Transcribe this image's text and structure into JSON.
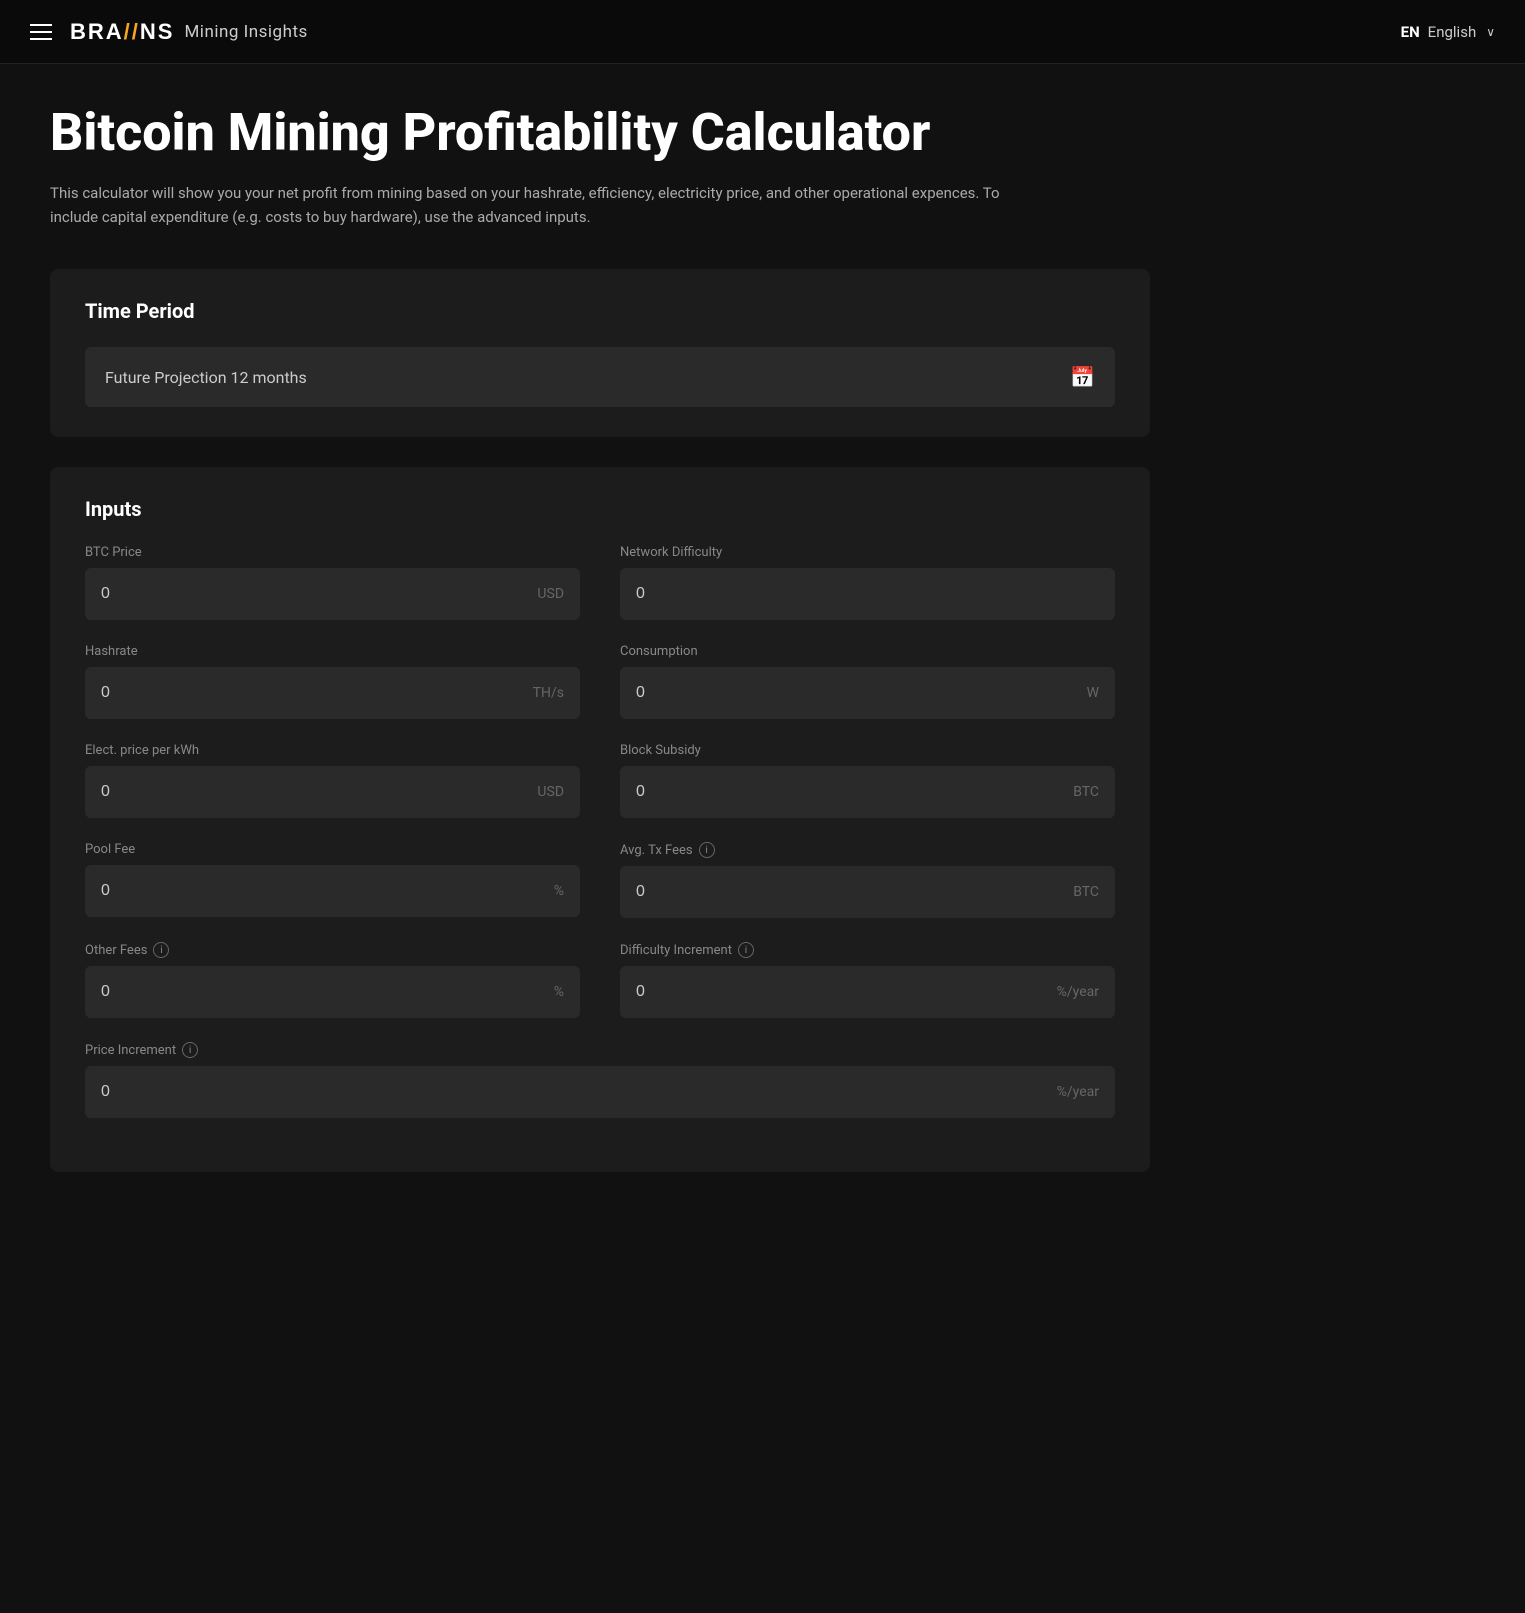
{
  "navbar": {
    "hamburger_label": "menu",
    "brand_logo": "BRA\\\\NS",
    "brand_logo_display": "BRA",
    "brand_slash": "\\\\",
    "brand_ns": "NS",
    "brand_subtitle": "Mining Insights",
    "lang_code": "EN",
    "lang_label": "English",
    "lang_chevron": "∨"
  },
  "page": {
    "title": "Bitcoin Mining Profitability Calculator",
    "description": "This calculator will show you your net profit from mining based on your hashrate, efficiency, electricity price, and other operational expences. To include capital expenditure (e.g. costs to buy hardware), use the advanced inputs."
  },
  "time_period": {
    "section_title": "Time Period",
    "selected_value": "Future Projection 12 months",
    "calendar_icon": "📅"
  },
  "inputs": {
    "section_title": "Inputs",
    "fields": [
      {
        "id": "btc-price",
        "label": "BTC Price",
        "value": "0",
        "unit": "USD",
        "has_info": false,
        "col": "left"
      },
      {
        "id": "network-difficulty",
        "label": "Network Difficulty",
        "value": "0",
        "unit": "",
        "has_info": false,
        "col": "right"
      },
      {
        "id": "hashrate",
        "label": "Hashrate",
        "value": "0",
        "unit": "TH/s",
        "has_info": false,
        "col": "left"
      },
      {
        "id": "consumption",
        "label": "Consumption",
        "value": "0",
        "unit": "W",
        "has_info": false,
        "col": "right"
      },
      {
        "id": "elect-price",
        "label": "Elect. price per kWh",
        "value": "0",
        "unit": "USD",
        "has_info": false,
        "col": "left"
      },
      {
        "id": "block-subsidy",
        "label": "Block Subsidy",
        "value": "0",
        "unit": "BTC",
        "has_info": false,
        "col": "right"
      },
      {
        "id": "pool-fee",
        "label": "Pool Fee",
        "value": "0",
        "unit": "%",
        "has_info": false,
        "col": "left"
      },
      {
        "id": "avg-tx-fees",
        "label": "Avg. Tx Fees",
        "value": "0",
        "unit": "BTC",
        "has_info": true,
        "col": "right"
      },
      {
        "id": "other-fees",
        "label": "Other Fees",
        "value": "0",
        "unit": "%",
        "has_info": true,
        "col": "left"
      },
      {
        "id": "difficulty-increment",
        "label": "Difficulty Increment",
        "value": "0",
        "unit": "%/year",
        "has_info": true,
        "col": "right"
      }
    ],
    "full_width_fields": [
      {
        "id": "price-increment",
        "label": "Price Increment",
        "value": "0",
        "unit": "%/year",
        "has_info": true
      }
    ],
    "info_icon_label": "ℹ"
  }
}
